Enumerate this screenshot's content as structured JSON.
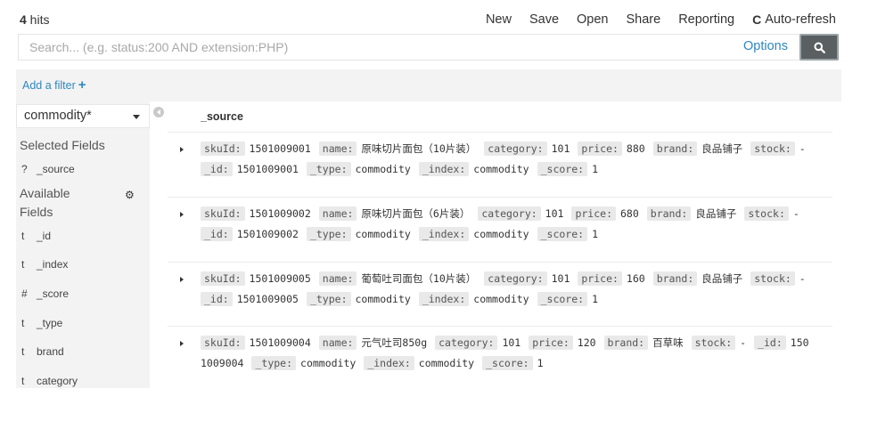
{
  "hits": {
    "count": "4",
    "label": " hits"
  },
  "topnav": {
    "new": "New",
    "save": "Save",
    "open": "Open",
    "share": "Share",
    "reporting": "Reporting",
    "auto_refresh": "Auto-refresh"
  },
  "search": {
    "value": "",
    "placeholder": "Search... (e.g. status:200 AND extension:PHP)",
    "options_label": "Options"
  },
  "filter": {
    "add_label": "Add a filter",
    "plus": "+"
  },
  "sidebar": {
    "index_pattern": "commodity*",
    "selected_title": "Selected Fields",
    "selected_fields": [
      {
        "type": "?",
        "name": "_source"
      }
    ],
    "available_title": "Available Fields",
    "available_fields": [
      {
        "type": "t",
        "name": "_id"
      },
      {
        "type": "t",
        "name": "_index"
      },
      {
        "type": "#",
        "name": "_score"
      },
      {
        "type": "t",
        "name": "_type"
      },
      {
        "type": "t",
        "name": "brand"
      },
      {
        "type": "t",
        "name": "category"
      }
    ]
  },
  "table": {
    "header": "_source",
    "documents": [
      {
        "line1": [
          {
            "k": "skuId:",
            "v": "1501009001"
          },
          {
            "k": "name:",
            "v": "原味切片面包（10片装）"
          },
          {
            "k": "category:",
            "v": "101"
          },
          {
            "k": "price:",
            "v": "880"
          },
          {
            "k": "brand:",
            "v": "良品铺子"
          },
          {
            "k": "stock:",
            "v": "-"
          }
        ],
        "line2": [
          {
            "k": "_id:",
            "v": "1501009001"
          },
          {
            "k": "_type:",
            "v": "commodity"
          },
          {
            "k": "_index:",
            "v": "commodity"
          },
          {
            "k": "_score:",
            "v": "1"
          }
        ]
      },
      {
        "line1": [
          {
            "k": "skuId:",
            "v": "1501009002"
          },
          {
            "k": "name:",
            "v": "原味切片面包（6片装）"
          },
          {
            "k": "category:",
            "v": "101"
          },
          {
            "k": "price:",
            "v": "680"
          },
          {
            "k": "brand:",
            "v": "良品铺子"
          },
          {
            "k": "stock:",
            "v": "-"
          }
        ],
        "line2": [
          {
            "k": "_id:",
            "v": "1501009002"
          },
          {
            "k": "_type:",
            "v": "commodity"
          },
          {
            "k": "_index:",
            "v": "commodity"
          },
          {
            "k": "_score:",
            "v": "1"
          }
        ]
      },
      {
        "line1": [
          {
            "k": "skuId:",
            "v": "1501009005"
          },
          {
            "k": "name:",
            "v": "葡萄吐司面包（10片装）"
          },
          {
            "k": "category:",
            "v": "101"
          },
          {
            "k": "price:",
            "v": "160"
          },
          {
            "k": "brand:",
            "v": "良品铺子"
          },
          {
            "k": "stock:",
            "v": "-"
          }
        ],
        "line2": [
          {
            "k": "_id:",
            "v": "1501009005"
          },
          {
            "k": "_type:",
            "v": "commodity"
          },
          {
            "k": "_index:",
            "v": "commodity"
          },
          {
            "k": "_score:",
            "v": "1"
          }
        ]
      },
      {
        "line1": [
          {
            "k": "skuId:",
            "v": "1501009004"
          },
          {
            "k": "name:",
            "v": "元气吐司850g"
          },
          {
            "k": "category:",
            "v": "101"
          },
          {
            "k": "price:",
            "v": "120"
          },
          {
            "k": "brand:",
            "v": "百草味"
          },
          {
            "k": "stock:",
            "v": "-"
          },
          {
            "k": "_id:",
            "v": "150"
          }
        ],
        "line2": [
          {
            "k": "",
            "v": "1009004"
          },
          {
            "k": "_type:",
            "v": "commodity"
          },
          {
            "k": "_index:",
            "v": "commodity"
          },
          {
            "k": "_score:",
            "v": "1"
          }
        ]
      }
    ]
  },
  "colors": {
    "link": "#2f87c2",
    "search_button": "#5a6062",
    "panel_bg": "#f3f3f3",
    "key_bg": "#e9e9e9"
  }
}
